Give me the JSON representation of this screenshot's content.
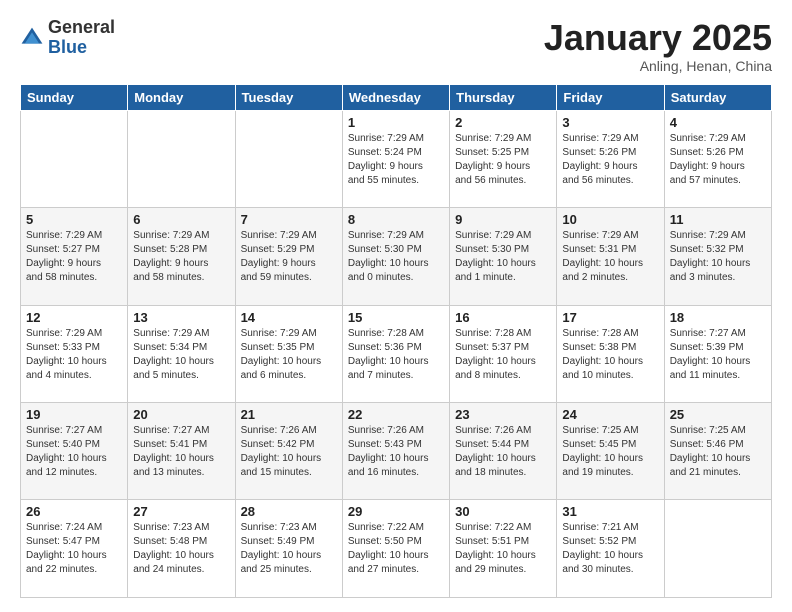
{
  "header": {
    "logo_general": "General",
    "logo_blue": "Blue",
    "month_title": "January 2025",
    "location": "Anling, Henan, China"
  },
  "weekdays": [
    "Sunday",
    "Monday",
    "Tuesday",
    "Wednesday",
    "Thursday",
    "Friday",
    "Saturday"
  ],
  "weeks": [
    [
      {
        "day": "",
        "detail": ""
      },
      {
        "day": "",
        "detail": ""
      },
      {
        "day": "",
        "detail": ""
      },
      {
        "day": "1",
        "detail": "Sunrise: 7:29 AM\nSunset: 5:24 PM\nDaylight: 9 hours\nand 55 minutes."
      },
      {
        "day": "2",
        "detail": "Sunrise: 7:29 AM\nSunset: 5:25 PM\nDaylight: 9 hours\nand 56 minutes."
      },
      {
        "day": "3",
        "detail": "Sunrise: 7:29 AM\nSunset: 5:26 PM\nDaylight: 9 hours\nand 56 minutes."
      },
      {
        "day": "4",
        "detail": "Sunrise: 7:29 AM\nSunset: 5:26 PM\nDaylight: 9 hours\nand 57 minutes."
      }
    ],
    [
      {
        "day": "5",
        "detail": "Sunrise: 7:29 AM\nSunset: 5:27 PM\nDaylight: 9 hours\nand 58 minutes."
      },
      {
        "day": "6",
        "detail": "Sunrise: 7:29 AM\nSunset: 5:28 PM\nDaylight: 9 hours\nand 58 minutes."
      },
      {
        "day": "7",
        "detail": "Sunrise: 7:29 AM\nSunset: 5:29 PM\nDaylight: 9 hours\nand 59 minutes."
      },
      {
        "day": "8",
        "detail": "Sunrise: 7:29 AM\nSunset: 5:30 PM\nDaylight: 10 hours\nand 0 minutes."
      },
      {
        "day": "9",
        "detail": "Sunrise: 7:29 AM\nSunset: 5:30 PM\nDaylight: 10 hours\nand 1 minute."
      },
      {
        "day": "10",
        "detail": "Sunrise: 7:29 AM\nSunset: 5:31 PM\nDaylight: 10 hours\nand 2 minutes."
      },
      {
        "day": "11",
        "detail": "Sunrise: 7:29 AM\nSunset: 5:32 PM\nDaylight: 10 hours\nand 3 minutes."
      }
    ],
    [
      {
        "day": "12",
        "detail": "Sunrise: 7:29 AM\nSunset: 5:33 PM\nDaylight: 10 hours\nand 4 minutes."
      },
      {
        "day": "13",
        "detail": "Sunrise: 7:29 AM\nSunset: 5:34 PM\nDaylight: 10 hours\nand 5 minutes."
      },
      {
        "day": "14",
        "detail": "Sunrise: 7:29 AM\nSunset: 5:35 PM\nDaylight: 10 hours\nand 6 minutes."
      },
      {
        "day": "15",
        "detail": "Sunrise: 7:28 AM\nSunset: 5:36 PM\nDaylight: 10 hours\nand 7 minutes."
      },
      {
        "day": "16",
        "detail": "Sunrise: 7:28 AM\nSunset: 5:37 PM\nDaylight: 10 hours\nand 8 minutes."
      },
      {
        "day": "17",
        "detail": "Sunrise: 7:28 AM\nSunset: 5:38 PM\nDaylight: 10 hours\nand 10 minutes."
      },
      {
        "day": "18",
        "detail": "Sunrise: 7:27 AM\nSunset: 5:39 PM\nDaylight: 10 hours\nand 11 minutes."
      }
    ],
    [
      {
        "day": "19",
        "detail": "Sunrise: 7:27 AM\nSunset: 5:40 PM\nDaylight: 10 hours\nand 12 minutes."
      },
      {
        "day": "20",
        "detail": "Sunrise: 7:27 AM\nSunset: 5:41 PM\nDaylight: 10 hours\nand 13 minutes."
      },
      {
        "day": "21",
        "detail": "Sunrise: 7:26 AM\nSunset: 5:42 PM\nDaylight: 10 hours\nand 15 minutes."
      },
      {
        "day": "22",
        "detail": "Sunrise: 7:26 AM\nSunset: 5:43 PM\nDaylight: 10 hours\nand 16 minutes."
      },
      {
        "day": "23",
        "detail": "Sunrise: 7:26 AM\nSunset: 5:44 PM\nDaylight: 10 hours\nand 18 minutes."
      },
      {
        "day": "24",
        "detail": "Sunrise: 7:25 AM\nSunset: 5:45 PM\nDaylight: 10 hours\nand 19 minutes."
      },
      {
        "day": "25",
        "detail": "Sunrise: 7:25 AM\nSunset: 5:46 PM\nDaylight: 10 hours\nand 21 minutes."
      }
    ],
    [
      {
        "day": "26",
        "detail": "Sunrise: 7:24 AM\nSunset: 5:47 PM\nDaylight: 10 hours\nand 22 minutes."
      },
      {
        "day": "27",
        "detail": "Sunrise: 7:23 AM\nSunset: 5:48 PM\nDaylight: 10 hours\nand 24 minutes."
      },
      {
        "day": "28",
        "detail": "Sunrise: 7:23 AM\nSunset: 5:49 PM\nDaylight: 10 hours\nand 25 minutes."
      },
      {
        "day": "29",
        "detail": "Sunrise: 7:22 AM\nSunset: 5:50 PM\nDaylight: 10 hours\nand 27 minutes."
      },
      {
        "day": "30",
        "detail": "Sunrise: 7:22 AM\nSunset: 5:51 PM\nDaylight: 10 hours\nand 29 minutes."
      },
      {
        "day": "31",
        "detail": "Sunrise: 7:21 AM\nSunset: 5:52 PM\nDaylight: 10 hours\nand 30 minutes."
      },
      {
        "day": "",
        "detail": ""
      }
    ]
  ]
}
